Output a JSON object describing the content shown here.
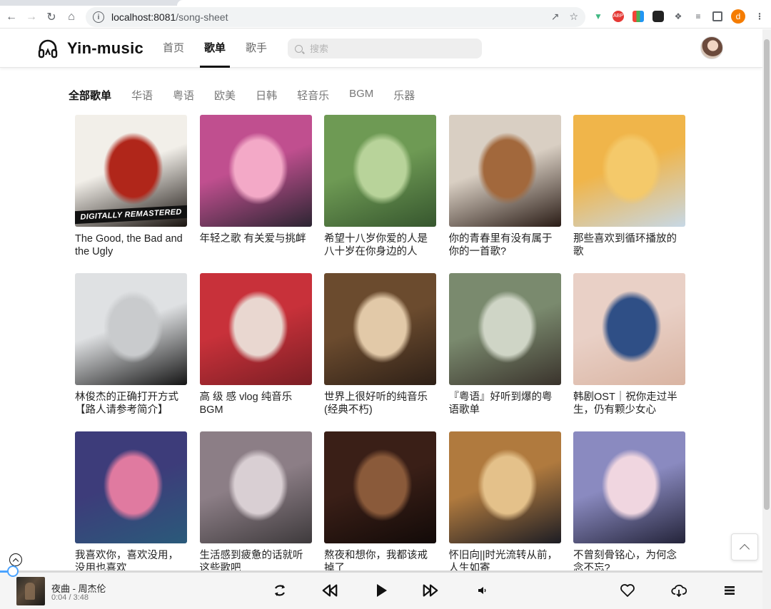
{
  "browser": {
    "url_host": "localhost:8081",
    "url_path": "/song-sheet",
    "profile_initial": "d"
  },
  "header": {
    "logo_text": "Yin-music",
    "nav": [
      {
        "label": "首页",
        "active": false
      },
      {
        "label": "歌单",
        "active": true
      },
      {
        "label": "歌手",
        "active": false
      }
    ],
    "search_placeholder": "搜索"
  },
  "categories": [
    {
      "label": "全部歌单",
      "active": true
    },
    {
      "label": "华语",
      "active": false
    },
    {
      "label": "粤语",
      "active": false
    },
    {
      "label": "欧美",
      "active": false
    },
    {
      "label": "日韩",
      "active": false
    },
    {
      "label": "轻音乐",
      "active": false
    },
    {
      "label": "BGM",
      "active": false
    },
    {
      "label": "乐器",
      "active": false
    }
  ],
  "playlists": [
    {
      "title": "The Good, the Bad and the Ugly",
      "cover_colors": [
        "#f2efe9",
        "#b0261a",
        "#1a1410"
      ],
      "cover_text": "DIGITALLY REMASTERED"
    },
    {
      "title": "年轻之歌 有关爱与挑衅",
      "cover_colors": [
        "#c04f8f",
        "#f3a9c7",
        "#2c2532"
      ]
    },
    {
      "title": "希望十八岁你爱的人是八十岁在你身边的人",
      "cover_colors": [
        "#6e9a54",
        "#b8d39a",
        "#36562e"
      ]
    },
    {
      "title": "你的青春里有没有属于你的一首歌?",
      "cover_colors": [
        "#d9cfc3",
        "#a2683c",
        "#2a1c16"
      ]
    },
    {
      "title": "那些喜欢到循环播放的歌",
      "cover_colors": [
        "#f0b54a",
        "#f4c96a",
        "#c7d8e6"
      ]
    },
    {
      "title": "林俊杰的正确打开方式【路人请参考简介】",
      "cover_colors": [
        "#dfe1e3",
        "#c9cbcd",
        "#151515"
      ]
    },
    {
      "title": "高 级 感 vlog 纯音乐BGM",
      "cover_colors": [
        "#c8313a",
        "#e9d7d0",
        "#7b1e24"
      ]
    },
    {
      "title": "世界上很好听的纯音乐(经典不朽)",
      "cover_colors": [
        "#6b4b2e",
        "#e2c9a8",
        "#2e2017"
      ]
    },
    {
      "title": "『粤语』好听到爆的粤语歌单",
      "cover_colors": [
        "#7a8a6e",
        "#cfd5c6",
        "#3a332c"
      ]
    },
    {
      "title": "韩剧OST｜祝你走过半生，仍有颗少女心",
      "cover_colors": [
        "#e9d0c6",
        "#2f4f86",
        "#d9b4a2"
      ]
    },
    {
      "title": "我喜欢你，喜欢没用，没用也喜欢",
      "cover_colors": [
        "#3d3c7a",
        "#e07aa0",
        "#2a5a7a"
      ]
    },
    {
      "title": "生活感到疲惫的话就听这些歌吧",
      "cover_colors": [
        "#8c7e86",
        "#d9cfd3",
        "#3e3a3c"
      ]
    },
    {
      "title": "熬夜和想你，我都该戒掉了",
      "cover_colors": [
        "#3a1f17",
        "#8a5a3a",
        "#120a08"
      ]
    },
    {
      "title": "怀旧向||时光流转从前，人生如寄",
      "cover_colors": [
        "#b07a3e",
        "#e4c18a",
        "#1d1d24"
      ]
    },
    {
      "title": "不曾刻骨铭心，为何念念不忘?",
      "cover_colors": [
        "#8a8ac0",
        "#f0d6e0",
        "#24243a"
      ]
    }
  ],
  "player": {
    "song": "夜曲 - 周杰伦",
    "time": "0:04 / 3:48",
    "progress_fraction": 0.017
  }
}
